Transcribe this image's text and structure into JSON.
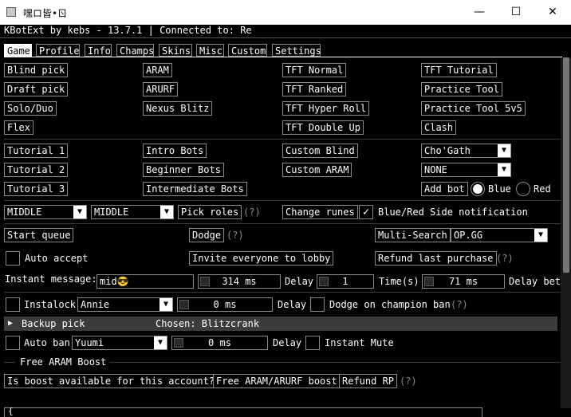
{
  "window": {
    "title": "嘿ロ皆•ㄖ",
    "minimize": "—",
    "maximize": "☐",
    "close": "✕"
  },
  "status_line": "KBotExt by kebs - 13.7.1 | Connected to: Re",
  "tabs": [
    "Game",
    "Profile",
    "Info",
    "Champs",
    "Skins",
    "Misc",
    "Custom",
    "Settings"
  ],
  "active_tab": "Game",
  "queues": {
    "col1": [
      "Blind pick",
      "Draft pick",
      "Solo/Duo",
      "Flex"
    ],
    "col2": [
      "ARAM",
      "ARURF",
      "Nexus Blitz"
    ],
    "col3": [
      "TFT Normal",
      "TFT Ranked",
      "TFT Hyper Roll",
      "TFT Double Up"
    ],
    "col4": [
      "TFT Tutorial",
      "Practice Tool",
      "Practice Tool 5v5",
      "Clash"
    ]
  },
  "practice": {
    "col1": [
      "Tutorial 1",
      "Tutorial 2",
      "Tutorial 3"
    ],
    "col2": [
      "Intro Bots",
      "Beginner Bots",
      "Intermediate Bots"
    ],
    "col3": [
      "Custom Blind",
      "Custom ARAM"
    ],
    "bot_champion": "Cho'Gath",
    "bot_difficulty": "NONE",
    "add_bot": "Add bot",
    "team_blue": "Blue",
    "team_red": "Red"
  },
  "roles": {
    "primary": "MIDDLE",
    "secondary": "MIDDLE",
    "pick_roles": "Pick roles",
    "help": "(?)",
    "change_runes": "Change runes",
    "side_notification": "Blue/Red Side notification"
  },
  "lobby": {
    "start_queue": "Start queue",
    "dodge": "Dodge",
    "dodge_help": "(?)",
    "multi_search": "Multi-Search",
    "multi_search_site": "OP.GG",
    "auto_accept": "Auto accept",
    "invite_everyone": "Invite everyone to lobby",
    "refund_last_purchase": "Refund last purchase",
    "refund_help": "(?)"
  },
  "instant_message": {
    "label": "Instant message:",
    "value": "mid😎",
    "delay_value": "314 ms",
    "delay_label": "Delay",
    "times_value": "1",
    "times_label": "Time(s)",
    "between_value": "71 ms",
    "between_label": "Delay bet"
  },
  "instalock": {
    "label": "Instalock",
    "champion": "Annie",
    "delay_value": "0 ms",
    "delay_label": "Delay",
    "dodge_on_ban": "Dodge on champion ban",
    "help": "(?)"
  },
  "backup_pick": {
    "arrow": "▶",
    "label": "Backup pick",
    "chosen": "Chosen: Blitzcrank"
  },
  "auto_ban": {
    "label": "Auto ban",
    "champion": "Yuumi",
    "delay_value": "0 ms",
    "delay_label": "Delay",
    "instant_mute": "Instant Mute"
  },
  "aram_boost": {
    "header": "Free ARAM Boost",
    "check_available": "Is boost available for this account?",
    "free_boost": "Free ARAM/ARURF boost",
    "refund_rp": "Refund RP",
    "help": "(?)"
  },
  "console": {
    "text": "{"
  },
  "colors": {
    "background": "#000000",
    "titlebar": "#ffffff",
    "border": "#8a8a8a",
    "separator": "#3a3a3a",
    "collapsing_header": "#3c3c3c"
  }
}
